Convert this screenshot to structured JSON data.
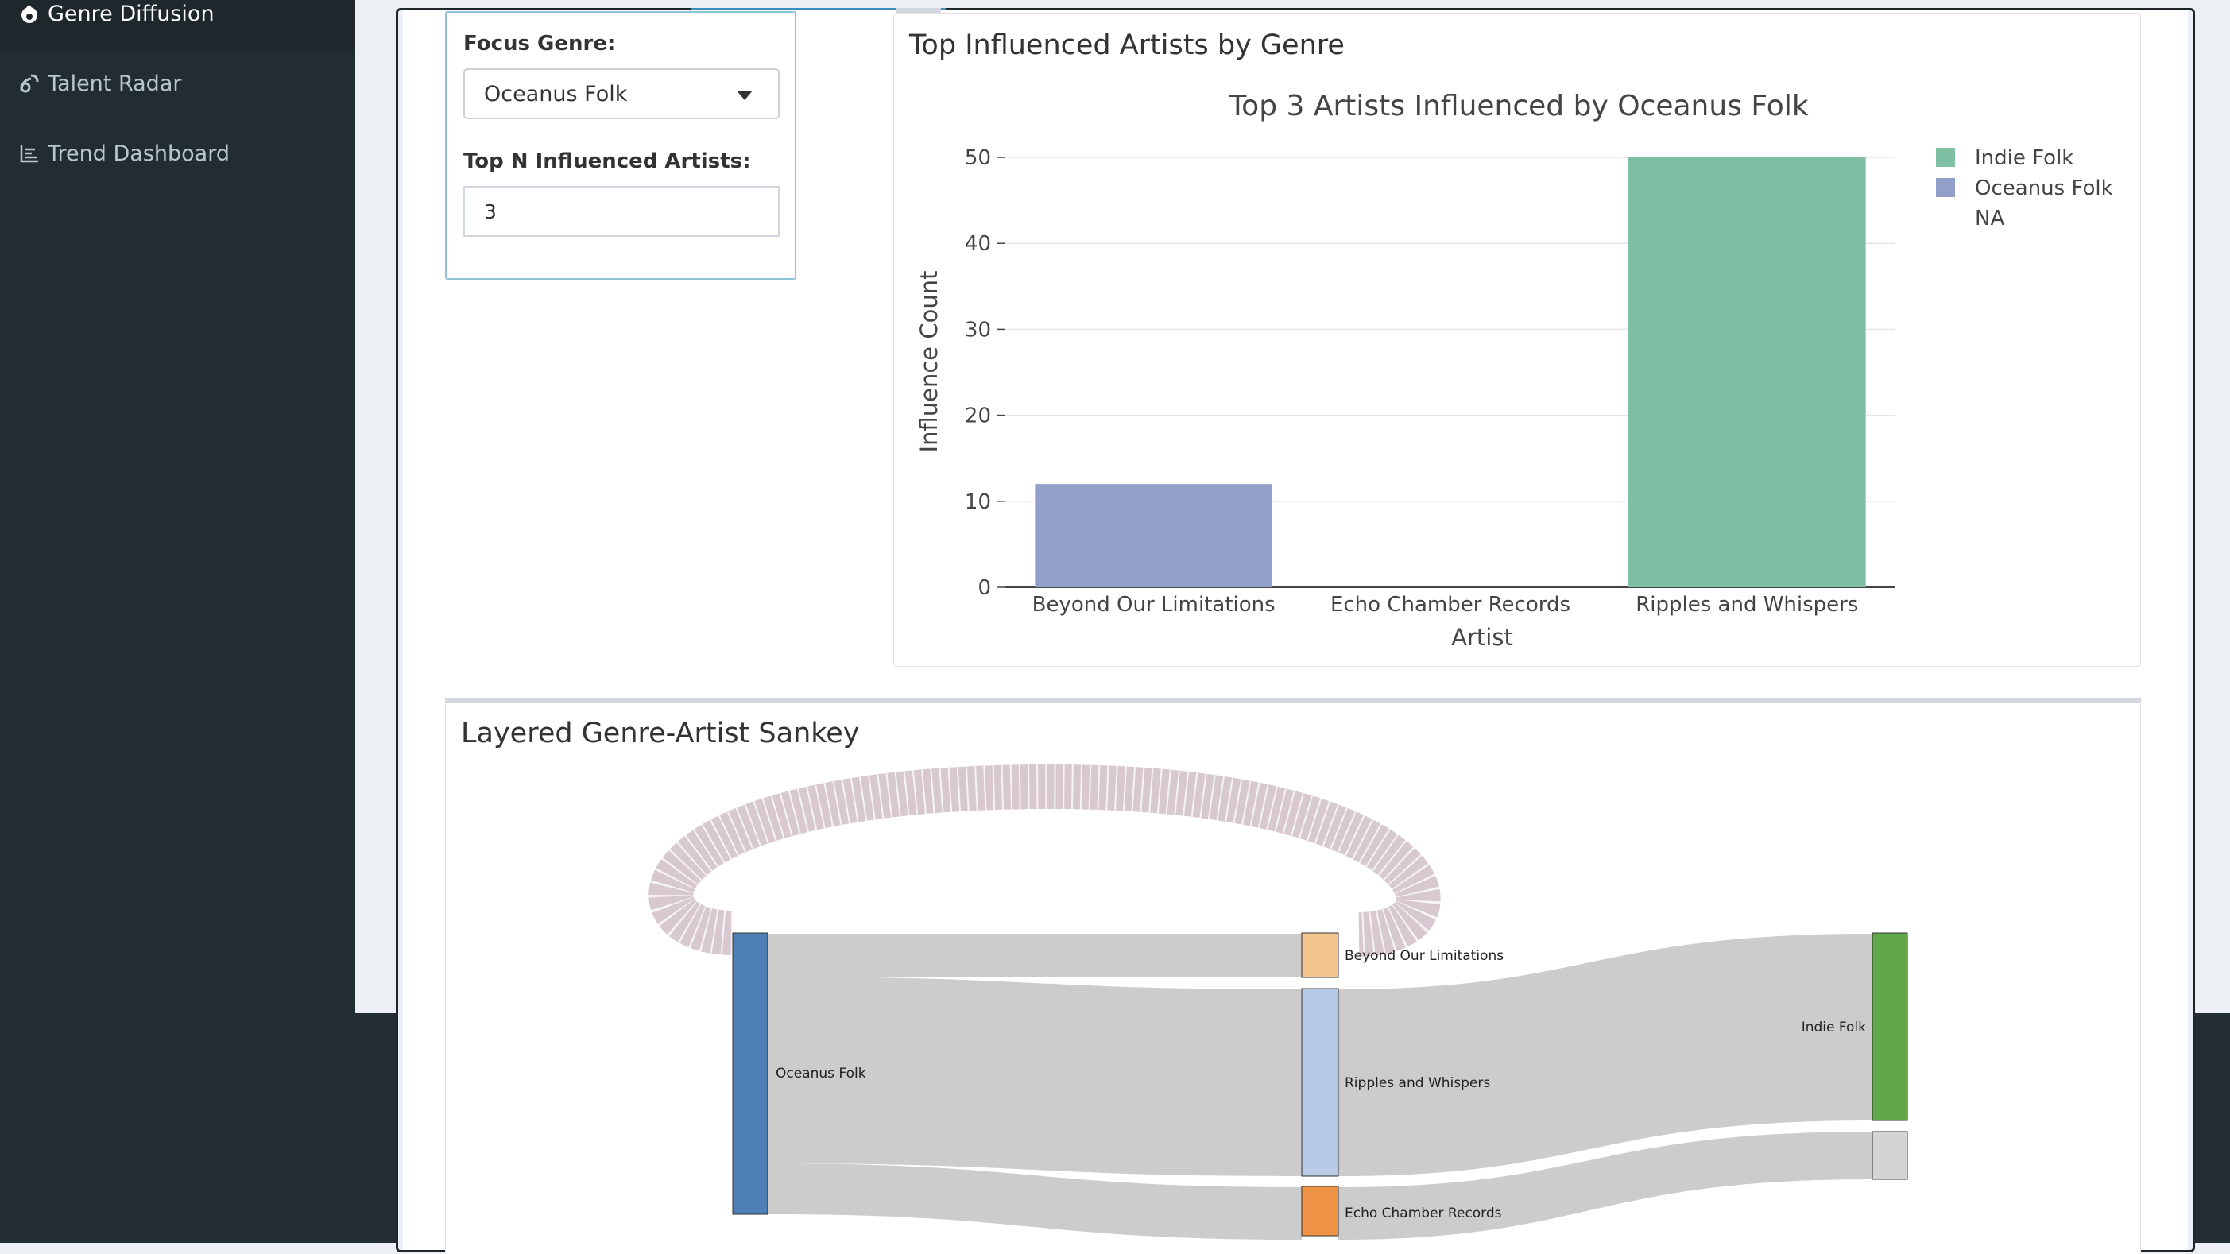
{
  "sidebar": {
    "items": [
      {
        "label": "Genre Diffusion",
        "icon": "fire-icon"
      },
      {
        "label": "Talent Radar",
        "icon": "satellite-dish-icon"
      },
      {
        "label": "Trend Dashboard",
        "icon": "line-chart-icon"
      }
    ]
  },
  "inputs": {
    "focus_genre_label": "Focus Genre:",
    "focus_genre_value": "Oceanus Folk",
    "top_n_label": "Top N Influenced Artists:",
    "top_n_value": "3"
  },
  "bar_panel": {
    "title": "Top Influenced Artists by Genre"
  },
  "sankey_panel": {
    "title": "Layered Genre-Artist Sankey",
    "nodes": [
      {
        "label": "Oceanus Folk",
        "color": "#4e7fb6"
      },
      {
        "label": "Beyond Our Limitations",
        "color": "#f3c58f"
      },
      {
        "label": "Ripples and Whispers",
        "color": "#b7cae6"
      },
      {
        "label": "Echo Chamber Records",
        "color": "#ef9347"
      },
      {
        "label": "Indie Folk",
        "color": "#61a74b"
      },
      {
        "label": "",
        "color": "#d4d4d4"
      }
    ]
  },
  "chart_data": {
    "type": "bar",
    "title": "Top 3 Artists Influenced by Oceanus Folk",
    "xlabel": "Artist",
    "ylabel": "Influence Count",
    "categories": [
      "Beyond Our Limitations",
      "Echo Chamber Records",
      "Ripples and Whispers"
    ],
    "series": [
      {
        "name": "Indie Folk",
        "color": "#7fc0a5",
        "values": [
          0,
          0,
          50
        ]
      },
      {
        "name": "Oceanus Folk",
        "color": "#929fc8",
        "values": [
          12,
          0,
          0
        ]
      },
      {
        "name": "NA",
        "color": null,
        "values": [
          0,
          0,
          0
        ]
      }
    ],
    "ylim": [
      0,
      50
    ],
    "yticks": [
      0,
      10,
      20,
      30,
      40,
      50
    ],
    "grid": true,
    "legend": "top-right"
  }
}
